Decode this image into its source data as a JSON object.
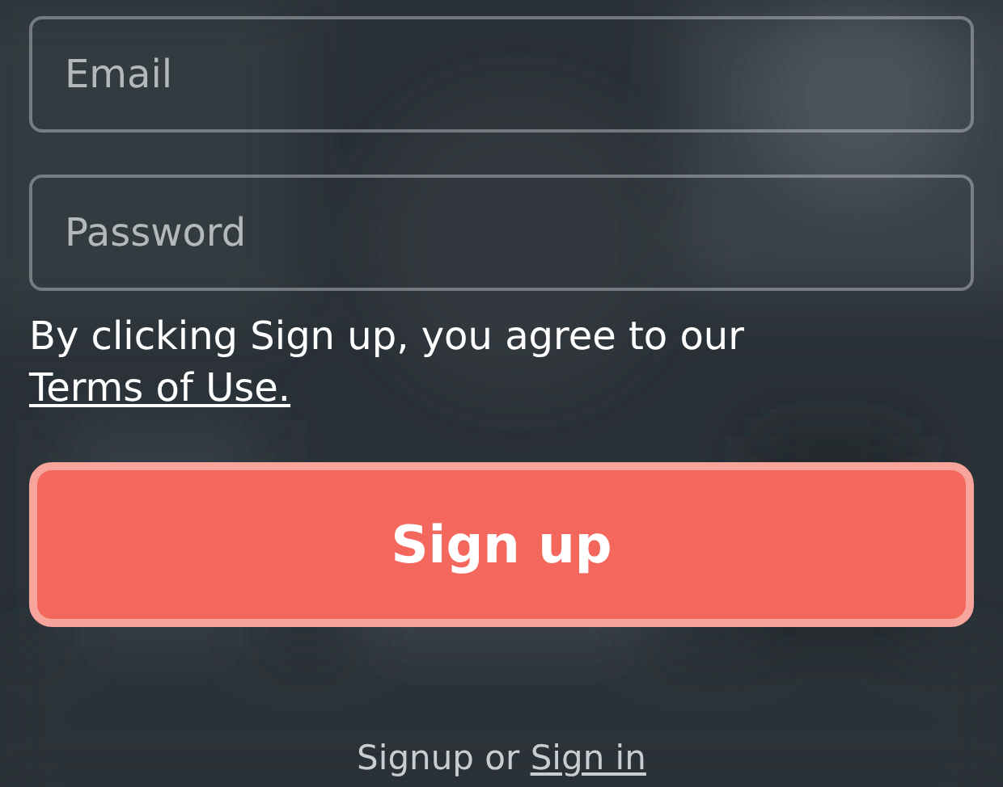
{
  "email": {
    "placeholder": "Email"
  },
  "password": {
    "placeholder": "Password"
  },
  "terms": {
    "text": "By clicking Sign up, you agree to our",
    "link": "Terms of Use."
  },
  "signup_button": "Sign up",
  "footer": {
    "text": "Signup or",
    "link": "Sign in"
  }
}
